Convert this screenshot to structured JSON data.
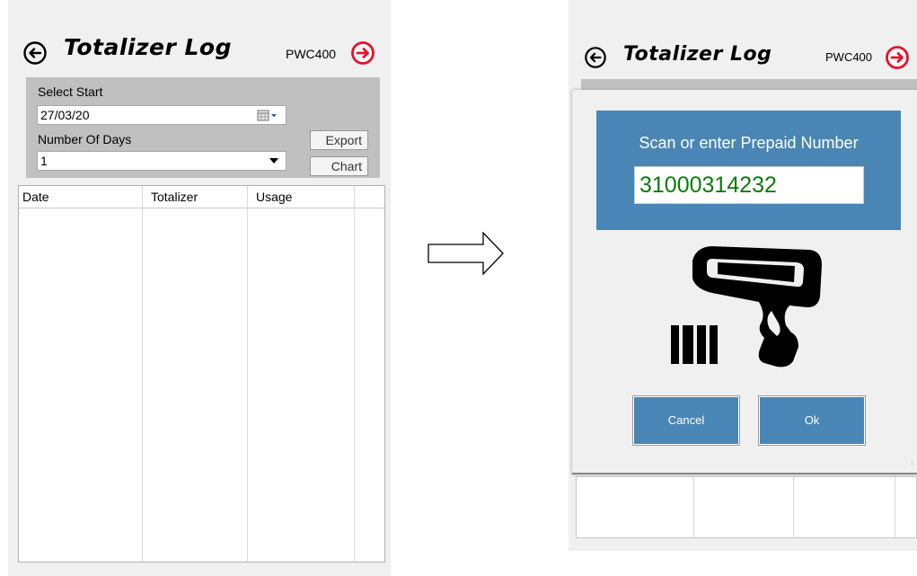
{
  "left_screen": {
    "title": "Totalizer Log",
    "device": "PWC400",
    "select_start_label": "Select Start",
    "start_date": "27/03/20",
    "number_of_days_label": "Number Of Days",
    "number_of_days": "1",
    "export_label": "Export",
    "chart_label": "Chart",
    "columns": [
      "Date",
      "Totalizer",
      "Usage"
    ]
  },
  "right_screen": {
    "title": "Totalizer Log",
    "device": "PWC400",
    "scan_prompt": "Scan or enter Prepaid Number",
    "prepaid_number": "31000314232",
    "cancel_label": "Cancel",
    "ok_label": "Ok"
  },
  "colors": {
    "panel_bg": "#f0f0f0",
    "filter_bg": "#c0c0c0",
    "accent_blue": "#4a86b5",
    "forward_red": "#e8102a",
    "number_green": "#0b7a0b"
  },
  "icons": {
    "back": "circle-left-arrow-icon",
    "forward": "red-circle-right-arrow-icon",
    "calendar": "calendar-icon",
    "dropdown": "chevron-down-icon",
    "transition": "outline-right-arrow-icon",
    "scanner": "barcode-scanner-icon"
  }
}
